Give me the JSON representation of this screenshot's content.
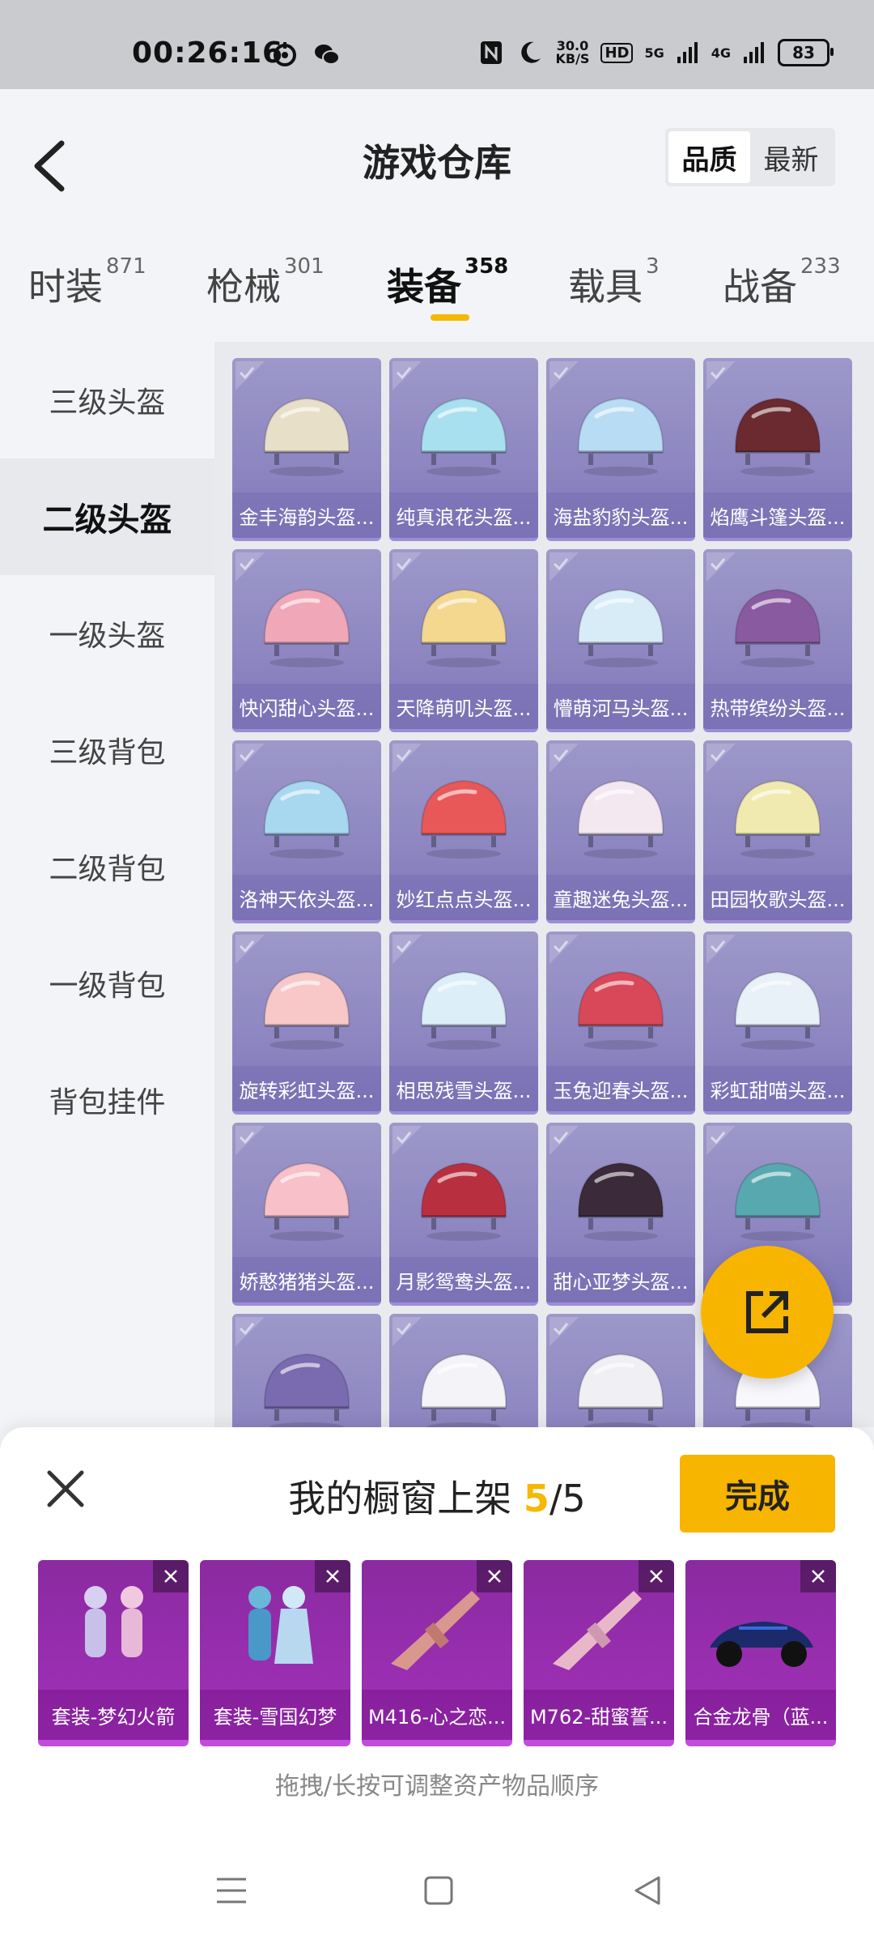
{
  "status_bar": {
    "time": "00:26:16",
    "net_speed_value": "30.0",
    "net_speed_unit": "KB/S",
    "hd_label": "HD",
    "net_5g": "5G",
    "net_4g": "4G",
    "battery": "83"
  },
  "header": {
    "title": "游戏仓库",
    "sort_options": [
      "品质",
      "最新"
    ],
    "sort_selected": "品质"
  },
  "tabs": [
    {
      "label": "时装",
      "count": "871"
    },
    {
      "label": "枪械",
      "count": "301"
    },
    {
      "label": "装备",
      "count": "358",
      "active": true
    },
    {
      "label": "载具",
      "count": "3"
    },
    {
      "label": "战备",
      "count": "233"
    }
  ],
  "sidebar": {
    "items": [
      "三级头盔",
      "二级头盔",
      "一级头盔",
      "三级背包",
      "二级背包",
      "一级背包",
      "背包挂件"
    ],
    "active": "二级头盔"
  },
  "grid": {
    "items": [
      {
        "name": "金丰海韵头盔...",
        "color": "#e8dfc8"
      },
      {
        "name": "纯真浪花头盔...",
        "color": "#a8e0f0"
      },
      {
        "name": "海盐豹豹头盔...",
        "color": "#b8dcf4"
      },
      {
        "name": "焰鹰斗篷头盔...",
        "color": "#6a2a30"
      },
      {
        "name": "快闪甜心头盔...",
        "color": "#f0a8b8"
      },
      {
        "name": "天降萌叽头盔...",
        "color": "#f4d890"
      },
      {
        "name": "懵萌河马头盔...",
        "color": "#d8ecf8"
      },
      {
        "name": "热带缤纷头盔...",
        "color": "#8a5aa0"
      },
      {
        "name": "洛神天依头盔...",
        "color": "#a8d8f0"
      },
      {
        "name": "妙红点点头盔...",
        "color": "#e85858"
      },
      {
        "name": "童趣迷兔头盔...",
        "color": "#f4e8f0"
      },
      {
        "name": "田园牧歌头盔...",
        "color": "#f0eab0"
      },
      {
        "name": "旋转彩虹头盔...",
        "color": "#f8c8c8"
      },
      {
        "name": "相思残雪头盔...",
        "color": "#dceef8"
      },
      {
        "name": "玉兔迎春头盔...",
        "color": "#d84858"
      },
      {
        "name": "彩虹甜喵头盔...",
        "color": "#e8f0f8"
      },
      {
        "name": "娇憨猪猪头盔...",
        "color": "#f8c0c8"
      },
      {
        "name": "月影鸳鸯头盔...",
        "color": "#b83040"
      },
      {
        "name": "甜心亚梦头盔...",
        "color": "#3a2a3a"
      },
      {
        "name": "",
        "color": "#58a8b0"
      },
      {
        "name": "",
        "color": "#7a6ab0"
      },
      {
        "name": "",
        "color": "#f4f4f8"
      },
      {
        "name": "",
        "color": "#f0f0f4"
      },
      {
        "name": "",
        "color": "#f8f8fc"
      }
    ]
  },
  "fab": {
    "icon": "share-external-icon"
  },
  "showcase": {
    "title_prefix": "我的橱窗上架 ",
    "current": "5",
    "total": "/5",
    "done_label": "完成",
    "items": [
      {
        "name": "套装-梦幻火箭"
      },
      {
        "name": "套装-雪国幻梦"
      },
      {
        "name": "M416-心之恋..."
      },
      {
        "name": "M762-甜蜜誓..."
      },
      {
        "name": "合金龙骨（蓝..."
      }
    ],
    "hint": "拖拽/长按可调整资产物品顺序"
  }
}
